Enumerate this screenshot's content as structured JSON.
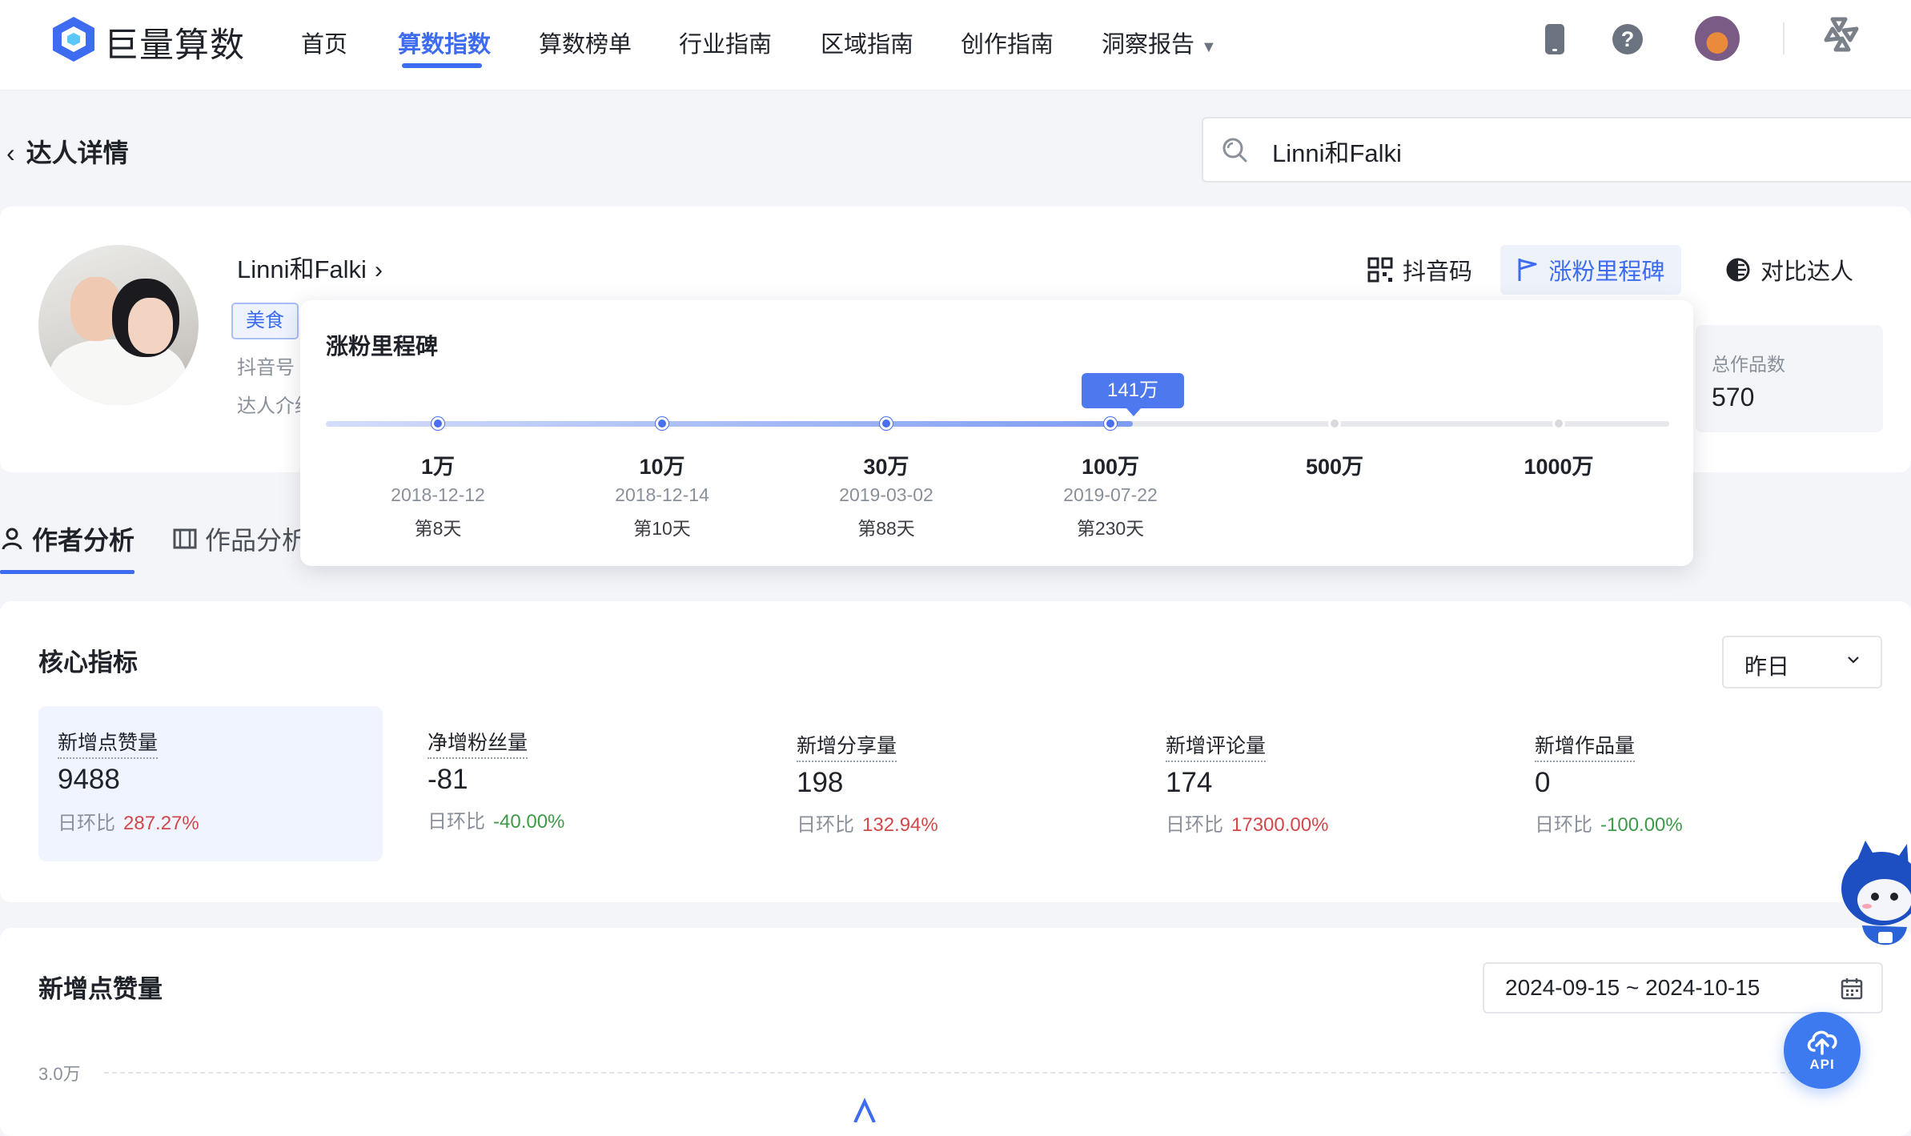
{
  "brand": {
    "name": "巨量算数"
  },
  "nav": {
    "items": [
      {
        "label": "首页"
      },
      {
        "label": "算数指数"
      },
      {
        "label": "算数榜单"
      },
      {
        "label": "行业指南"
      },
      {
        "label": "区域指南"
      },
      {
        "label": "创作指南"
      },
      {
        "label": "洞察报告"
      }
    ],
    "active": "算数指数"
  },
  "page": {
    "back_title": "达人详情"
  },
  "search": {
    "value": "Linni和Falki"
  },
  "profile": {
    "name": "Linni和Falki",
    "tag": "美食",
    "douyin_id_label": "抖音号",
    "intro_label": "达人介绍",
    "actions": {
      "qr": "抖音码",
      "milestone": "涨粉里程碑",
      "compare": "对比达人"
    },
    "total_works_label": "总作品数",
    "total_works_value": "570"
  },
  "tabs": [
    {
      "label": "作者分析"
    },
    {
      "label": "作品分析"
    }
  ],
  "milestone": {
    "title": "涨粉里程碑",
    "current_label": "141万",
    "current_position": 3.1,
    "points": [
      {
        "label": "1万",
        "date": "2018-12-12",
        "day": "第8天",
        "reached": true
      },
      {
        "label": "10万",
        "date": "2018-12-14",
        "day": "第10天",
        "reached": true
      },
      {
        "label": "30万",
        "date": "2019-03-02",
        "day": "第88天",
        "reached": true
      },
      {
        "label": "100万",
        "date": "2019-07-22",
        "day": "第230天",
        "reached": true
      },
      {
        "label": "500万",
        "date": "",
        "day": "",
        "reached": false
      },
      {
        "label": "1000万",
        "date": "",
        "day": "",
        "reached": false
      }
    ]
  },
  "core": {
    "title": "核心指标",
    "range": "昨日",
    "compare_label": "日环比",
    "metrics": [
      {
        "label": "新增点赞量",
        "value": "9488",
        "change": "287.27%",
        "trend": "up"
      },
      {
        "label": "净增粉丝量",
        "value": "-81",
        "change": "-40.00%",
        "trend": "down"
      },
      {
        "label": "新增分享量",
        "value": "198",
        "change": "132.94%",
        "trend": "up"
      },
      {
        "label": "新增评论量",
        "value": "174",
        "change": "17300.00%",
        "trend": "up"
      },
      {
        "label": "新增作品量",
        "value": "0",
        "change": "-100.00%",
        "trend": "down"
      }
    ]
  },
  "trend": {
    "title": "新增点赞量",
    "date_range": "2024-09-15 ~ 2024-10-15",
    "y_tick_top": "3.0万"
  },
  "api_button": {
    "label": "API"
  },
  "colors": {
    "accent": "#3d6cf0",
    "up": "#d2484a",
    "down": "#3e9a49"
  }
}
